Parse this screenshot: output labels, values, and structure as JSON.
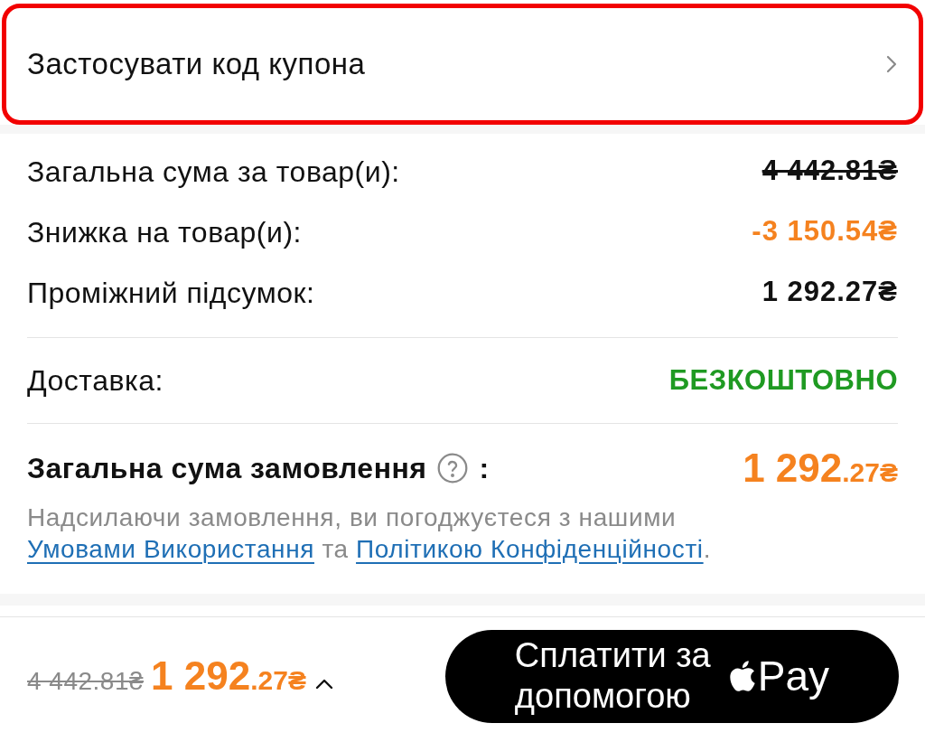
{
  "coupon": {
    "label": "Застосувати код купона"
  },
  "price_rows": [
    {
      "kind": "crossed",
      "label": "Загальна сума за товар(и):",
      "value": "4 442.81₴"
    },
    {
      "kind": "discount",
      "label": "Знижка на товар(и):",
      "value": "-3 150.54₴"
    },
    {
      "kind": "plain",
      "label": "Проміжний підсумок:",
      "value": "1 292.27₴"
    }
  ],
  "shipping": {
    "label": "Доставка:",
    "value": "БЕЗКОШТОВНО"
  },
  "order_total": {
    "label": "Загальна сума замовлення",
    "suffix": ":",
    "value_whole": "1 292",
    "value_fraction": ".27₴"
  },
  "terms": [
    {
      "kind": "text",
      "text": "Надсилаючи замовлення, ви погоджуєтеся з нашими "
    },
    {
      "kind": "link",
      "text": "Умовами Використання"
    },
    {
      "kind": "text",
      "text": " та "
    },
    {
      "kind": "link",
      "text": "Політикою Конфіденційності"
    },
    {
      "kind": "text",
      "text": "."
    }
  ],
  "bottom_bar": {
    "old_price": "4 442.81₴",
    "price_whole": "1 292",
    "price_fraction": ".27₴",
    "pay_button": {
      "text": "Сплатити за допомогою",
      "brand_text": "Pay"
    }
  }
}
